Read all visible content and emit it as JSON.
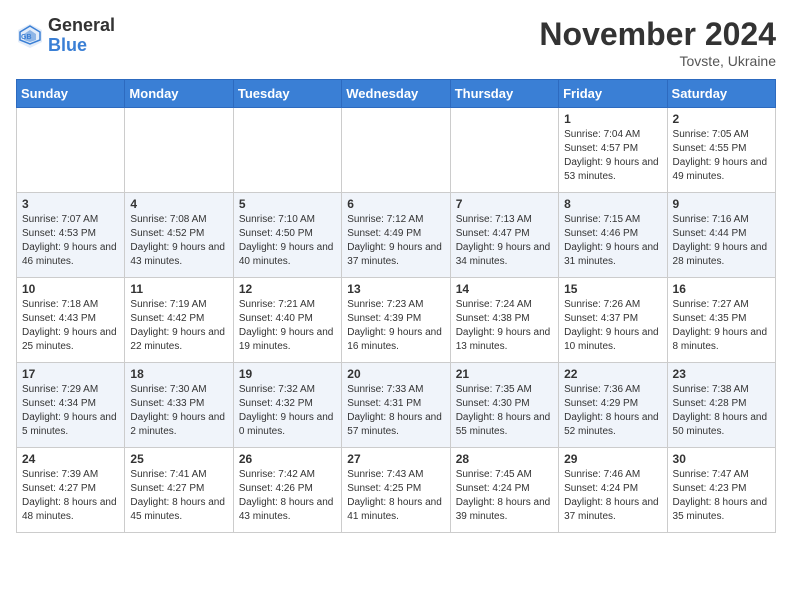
{
  "logo": {
    "line1": "General",
    "line2": "Blue"
  },
  "title": "November 2024",
  "location": "Tovste, Ukraine",
  "weekdays": [
    "Sunday",
    "Monday",
    "Tuesday",
    "Wednesday",
    "Thursday",
    "Friday",
    "Saturday"
  ],
  "weeks": [
    [
      {
        "day": "",
        "info": ""
      },
      {
        "day": "",
        "info": ""
      },
      {
        "day": "",
        "info": ""
      },
      {
        "day": "",
        "info": ""
      },
      {
        "day": "",
        "info": ""
      },
      {
        "day": "1",
        "info": "Sunrise: 7:04 AM\nSunset: 4:57 PM\nDaylight: 9 hours and 53 minutes."
      },
      {
        "day": "2",
        "info": "Sunrise: 7:05 AM\nSunset: 4:55 PM\nDaylight: 9 hours and 49 minutes."
      }
    ],
    [
      {
        "day": "3",
        "info": "Sunrise: 7:07 AM\nSunset: 4:53 PM\nDaylight: 9 hours and 46 minutes."
      },
      {
        "day": "4",
        "info": "Sunrise: 7:08 AM\nSunset: 4:52 PM\nDaylight: 9 hours and 43 minutes."
      },
      {
        "day": "5",
        "info": "Sunrise: 7:10 AM\nSunset: 4:50 PM\nDaylight: 9 hours and 40 minutes."
      },
      {
        "day": "6",
        "info": "Sunrise: 7:12 AM\nSunset: 4:49 PM\nDaylight: 9 hours and 37 minutes."
      },
      {
        "day": "7",
        "info": "Sunrise: 7:13 AM\nSunset: 4:47 PM\nDaylight: 9 hours and 34 minutes."
      },
      {
        "day": "8",
        "info": "Sunrise: 7:15 AM\nSunset: 4:46 PM\nDaylight: 9 hours and 31 minutes."
      },
      {
        "day": "9",
        "info": "Sunrise: 7:16 AM\nSunset: 4:44 PM\nDaylight: 9 hours and 28 minutes."
      }
    ],
    [
      {
        "day": "10",
        "info": "Sunrise: 7:18 AM\nSunset: 4:43 PM\nDaylight: 9 hours and 25 minutes."
      },
      {
        "day": "11",
        "info": "Sunrise: 7:19 AM\nSunset: 4:42 PM\nDaylight: 9 hours and 22 minutes."
      },
      {
        "day": "12",
        "info": "Sunrise: 7:21 AM\nSunset: 4:40 PM\nDaylight: 9 hours and 19 minutes."
      },
      {
        "day": "13",
        "info": "Sunrise: 7:23 AM\nSunset: 4:39 PM\nDaylight: 9 hours and 16 minutes."
      },
      {
        "day": "14",
        "info": "Sunrise: 7:24 AM\nSunset: 4:38 PM\nDaylight: 9 hours and 13 minutes."
      },
      {
        "day": "15",
        "info": "Sunrise: 7:26 AM\nSunset: 4:37 PM\nDaylight: 9 hours and 10 minutes."
      },
      {
        "day": "16",
        "info": "Sunrise: 7:27 AM\nSunset: 4:35 PM\nDaylight: 9 hours and 8 minutes."
      }
    ],
    [
      {
        "day": "17",
        "info": "Sunrise: 7:29 AM\nSunset: 4:34 PM\nDaylight: 9 hours and 5 minutes."
      },
      {
        "day": "18",
        "info": "Sunrise: 7:30 AM\nSunset: 4:33 PM\nDaylight: 9 hours and 2 minutes."
      },
      {
        "day": "19",
        "info": "Sunrise: 7:32 AM\nSunset: 4:32 PM\nDaylight: 9 hours and 0 minutes."
      },
      {
        "day": "20",
        "info": "Sunrise: 7:33 AM\nSunset: 4:31 PM\nDaylight: 8 hours and 57 minutes."
      },
      {
        "day": "21",
        "info": "Sunrise: 7:35 AM\nSunset: 4:30 PM\nDaylight: 8 hours and 55 minutes."
      },
      {
        "day": "22",
        "info": "Sunrise: 7:36 AM\nSunset: 4:29 PM\nDaylight: 8 hours and 52 minutes."
      },
      {
        "day": "23",
        "info": "Sunrise: 7:38 AM\nSunset: 4:28 PM\nDaylight: 8 hours and 50 minutes."
      }
    ],
    [
      {
        "day": "24",
        "info": "Sunrise: 7:39 AM\nSunset: 4:27 PM\nDaylight: 8 hours and 48 minutes."
      },
      {
        "day": "25",
        "info": "Sunrise: 7:41 AM\nSunset: 4:27 PM\nDaylight: 8 hours and 45 minutes."
      },
      {
        "day": "26",
        "info": "Sunrise: 7:42 AM\nSunset: 4:26 PM\nDaylight: 8 hours and 43 minutes."
      },
      {
        "day": "27",
        "info": "Sunrise: 7:43 AM\nSunset: 4:25 PM\nDaylight: 8 hours and 41 minutes."
      },
      {
        "day": "28",
        "info": "Sunrise: 7:45 AM\nSunset: 4:24 PM\nDaylight: 8 hours and 39 minutes."
      },
      {
        "day": "29",
        "info": "Sunrise: 7:46 AM\nSunset: 4:24 PM\nDaylight: 8 hours and 37 minutes."
      },
      {
        "day": "30",
        "info": "Sunrise: 7:47 AM\nSunset: 4:23 PM\nDaylight: 8 hours and 35 minutes."
      }
    ]
  ]
}
